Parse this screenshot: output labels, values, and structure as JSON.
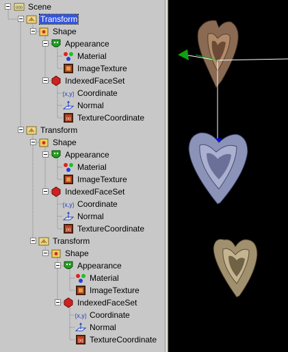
{
  "tree": {
    "root": {
      "label": "Scene",
      "icon": "scene-icon"
    },
    "transforms": [
      {
        "label": "Transform",
        "selected": true,
        "shape": {
          "label": "Shape",
          "appearance": {
            "label": "Appearance",
            "material": "Material",
            "image_texture": "ImageTexture"
          },
          "indexed_face_set": {
            "label": "IndexedFaceSet",
            "coordinate": "Coordinate",
            "normal": "Normal",
            "texture_coordinate": "TextureCoordinate"
          }
        }
      },
      {
        "label": "Transform",
        "selected": false,
        "shape": {
          "label": "Shape",
          "appearance": {
            "label": "Appearance",
            "material": "Material",
            "image_texture": "ImageTexture"
          },
          "indexed_face_set": {
            "label": "IndexedFaceSet",
            "coordinate": "Coordinate",
            "normal": "Normal",
            "texture_coordinate": "TextureCoordinate"
          }
        }
      },
      {
        "label": "Transform",
        "selected": false,
        "shape": {
          "label": "Shape",
          "appearance": {
            "label": "Appearance",
            "material": "Material",
            "image_texture": "ImageTexture"
          },
          "indexed_face_set": {
            "label": "IndexedFaceSet",
            "coordinate": "Coordinate",
            "normal": "Normal",
            "texture_coordinate": "TextureCoordinate"
          }
        }
      }
    ]
  },
  "viewport": {
    "background": "#000000",
    "objects": [
      {
        "name": "heart-mesh-brown",
        "color": "#8a6a52"
      },
      {
        "name": "heart-mesh-blue",
        "color": "#8c93b8"
      },
      {
        "name": "heart-mesh-tan",
        "color": "#a0906e"
      }
    ],
    "gizmo": {
      "x_axis_color": "#ffffff",
      "y_axis_color": "#0000ff",
      "z_axis_color": "#00aa00"
    }
  },
  "colors": {
    "selection": "#3355dd",
    "panel_bg": "#c8c8c8"
  }
}
